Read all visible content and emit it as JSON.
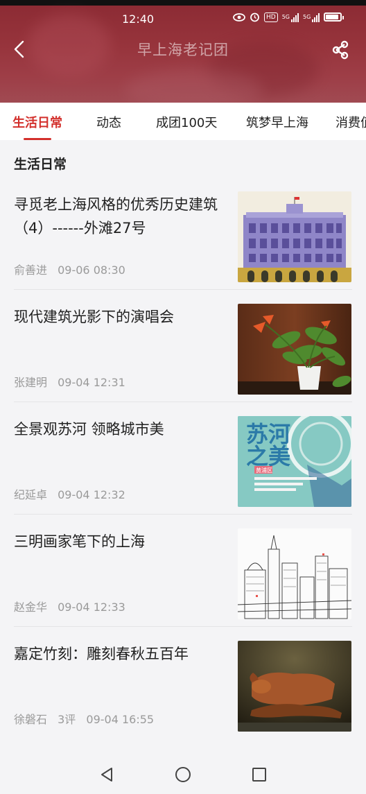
{
  "status_bar": {
    "time": "12:40",
    "hd": "HD",
    "net1": "5G",
    "net2": "5G"
  },
  "header": {
    "title": "早上海老记团"
  },
  "tabs": [
    {
      "label": "生活日常",
      "active": true
    },
    {
      "label": "动态",
      "active": false
    },
    {
      "label": "成团100天",
      "active": false
    },
    {
      "label": "筑梦早上海",
      "active": false
    },
    {
      "label": "消费值",
      "active": false
    }
  ],
  "section_title": "生活日常",
  "articles": [
    {
      "title": "寻觅老上海风格的优秀历史建筑（4）------外滩27号",
      "author": "俞善进",
      "comments": "",
      "time": "09-06 08:30",
      "image": "historic-building"
    },
    {
      "title": "现代建筑光影下的演唱会",
      "author": "张建明",
      "comments": "",
      "time": "09-04 12:31",
      "image": "potted-plant"
    },
    {
      "title": "全景观苏河 领略城市美",
      "author": "纪延卓",
      "comments": "",
      "time": "09-04 12:32",
      "image": "exhibition-poster",
      "image_text": "苏河之美",
      "image_subtext": "黄浦区"
    },
    {
      "title": "三明画家笔下的上海",
      "author": "赵金华",
      "comments": "",
      "time": "09-04 12:33",
      "image": "city-sketch"
    },
    {
      "title": "嘉定竹刻：雕刻春秋五百年",
      "author": "徐磐石",
      "comments": "3评",
      "time": "09-04 16:55",
      "image": "bamboo-carving"
    }
  ],
  "icons": {
    "back": "chevron-left-icon",
    "share": "share-icon",
    "nav_back": "triangle-back-icon",
    "nav_home": "circle-home-icon",
    "nav_recent": "square-recent-icon"
  },
  "colors": {
    "accent": "#d3302c",
    "header": "#97343c"
  }
}
